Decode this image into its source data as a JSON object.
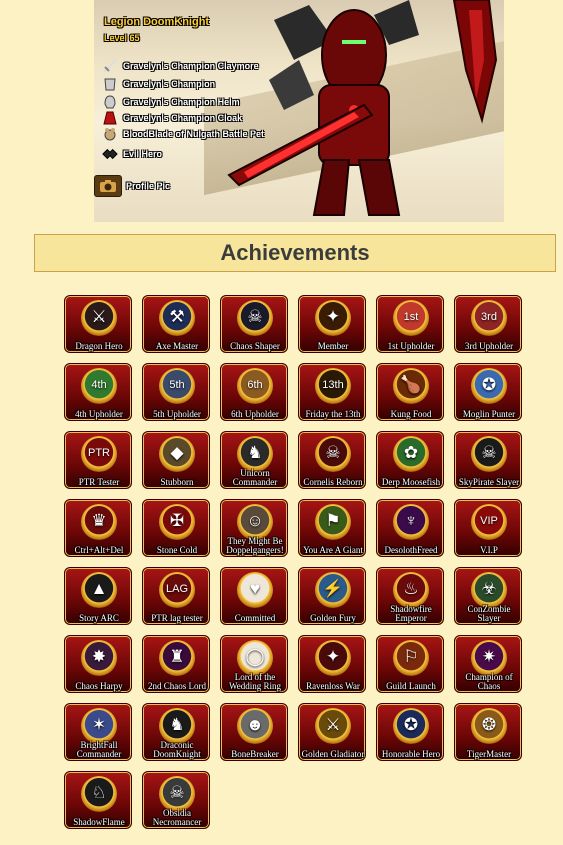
{
  "character": {
    "name": "Legion DoomKnight",
    "level": "Level 65",
    "equipment": [
      {
        "label": "Gravelyn's Champion Claymore",
        "icon": "sword-icon"
      },
      {
        "label": "Gravelyn's Champion",
        "icon": "armor-icon"
      },
      {
        "label": "Gravelyn's Champion Helm",
        "icon": "helm-icon"
      },
      {
        "label": "Gravelyn's Champion Cloak",
        "icon": "cape-icon"
      },
      {
        "label": "BloodBlade of Nulgath Battle Pet",
        "icon": "pet-icon"
      },
      {
        "label": "Evil Hero",
        "icon": "faction-icon"
      }
    ],
    "profile_pic_label": "Profile Pic",
    "colors": {
      "name": "#ffcf31",
      "armor": "#8b1010"
    }
  },
  "achievements": {
    "title": "Achievements",
    "badges": [
      {
        "label": "Dragon Hero",
        "glyph": "⚔",
        "inner": "#2a1a1a"
      },
      {
        "label": "Axe Master",
        "glyph": "⚒",
        "inner": "#1d2d55"
      },
      {
        "label": "Chaos Shaper",
        "glyph": "☠",
        "inner": "#1a1a2a"
      },
      {
        "label": "Member",
        "glyph": "✦",
        "inner": "#3a1c05"
      },
      {
        "label": "1st Upholder",
        "glyph": "1st",
        "inner": "#c0392b"
      },
      {
        "label": "3rd Upholder",
        "glyph": "3rd",
        "inner": "#8e2424"
      },
      {
        "label": "4th Upholder",
        "glyph": "4th",
        "inner": "#2f7a2f"
      },
      {
        "label": "5th Upholder",
        "glyph": "5th",
        "inner": "#3a4a6a"
      },
      {
        "label": "6th Upholder",
        "glyph": "6th",
        "inner": "#8a5a20"
      },
      {
        "label": "Friday the 13th",
        "glyph": "13th",
        "inner": "#2a1a05"
      },
      {
        "label": "Kung Food",
        "glyph": "🍗",
        "inner": "#6a2a05"
      },
      {
        "label": "Moglin Punter",
        "glyph": "✪",
        "inner": "#3a6ab0"
      },
      {
        "label": "PTR Tester",
        "glyph": "PTR",
        "inner": "#7a0a0a"
      },
      {
        "label": "Stubborn",
        "glyph": "◆",
        "inner": "#5a4a2a"
      },
      {
        "label": "Unicorn Commander",
        "glyph": "♞",
        "inner": "#2a2a2a"
      },
      {
        "label": "Cornelis Reborn",
        "glyph": "☠",
        "inner": "#4a0a0a"
      },
      {
        "label": "Derp Moosefish",
        "glyph": "✿",
        "inner": "#2a6a2a"
      },
      {
        "label": "SkyPirate Slayer",
        "glyph": "☠",
        "inner": "#1a1a1a"
      },
      {
        "label": "Ctrl+Alt+Del",
        "glyph": "♛",
        "inner": "#6a0a0a"
      },
      {
        "label": "Stone Cold",
        "glyph": "✠",
        "inner": "#7a0a0a"
      },
      {
        "label": "They Might Be Doppelgangers!",
        "glyph": "☺",
        "inner": "#5a4a3a"
      },
      {
        "label": "You Are A Giant",
        "glyph": "⚑",
        "inner": "#3a5a1a"
      },
      {
        "label": "DesolothFreed",
        "glyph": "♆",
        "inner": "#3a0a4a"
      },
      {
        "label": "V.I.P",
        "glyph": "VIP",
        "inner": "#8a0a0a"
      },
      {
        "label": "Story ARC",
        "glyph": "▲",
        "inner": "#1a1a1a"
      },
      {
        "label": "PTR lag tester",
        "glyph": "LAG",
        "inner": "#6a0a0a"
      },
      {
        "label": "Committed",
        "glyph": "♥",
        "inner": "#eee6d8"
      },
      {
        "label": "Golden Fury",
        "glyph": "⚡",
        "inner": "#2a5a8a"
      },
      {
        "label": "Shadowfire Emperor",
        "glyph": "♨",
        "inner": "#6a0a0a"
      },
      {
        "label": "ConZombie Slayer",
        "glyph": "☣",
        "inner": "#2a4a2a"
      },
      {
        "label": "Chaos Harpy",
        "glyph": "✸",
        "inner": "#3a1a3a"
      },
      {
        "label": "2nd Chaos Lord",
        "glyph": "♜",
        "inner": "#3a0a3a"
      },
      {
        "label": "Lord of the Wedding Ring",
        "glyph": "◯",
        "inner": "#eee6d8"
      },
      {
        "label": "Ravenloss War",
        "glyph": "✦",
        "inner": "#4a0a0a"
      },
      {
        "label": "Guild Launch",
        "glyph": "⚐",
        "inner": "#7a2a0a"
      },
      {
        "label": "Champion of Chaos",
        "glyph": "✷",
        "inner": "#4a0a4a"
      },
      {
        "label": "BrightFall Commander",
        "glyph": "✶",
        "inner": "#3a4a8a"
      },
      {
        "label": "Draconic DoomKnight",
        "glyph": "♞",
        "inner": "#1a1a1a"
      },
      {
        "label": "BoneBreaker",
        "glyph": "☻",
        "inner": "#6a6a6a"
      },
      {
        "label": "Golden Gladiator",
        "glyph": "⚔",
        "inner": "#6a4a0a"
      },
      {
        "label": "Honorable Hero",
        "glyph": "✪",
        "inner": "#1a2a5a"
      },
      {
        "label": "TigerMaster",
        "glyph": "❂",
        "inner": "#8a5a1a"
      },
      {
        "label": "ShadowFlame",
        "glyph": "♘",
        "inner": "#1a1a1a"
      },
      {
        "label": "Obsidia Necromancer",
        "glyph": "☠",
        "inner": "#3a3a3a"
      }
    ]
  }
}
